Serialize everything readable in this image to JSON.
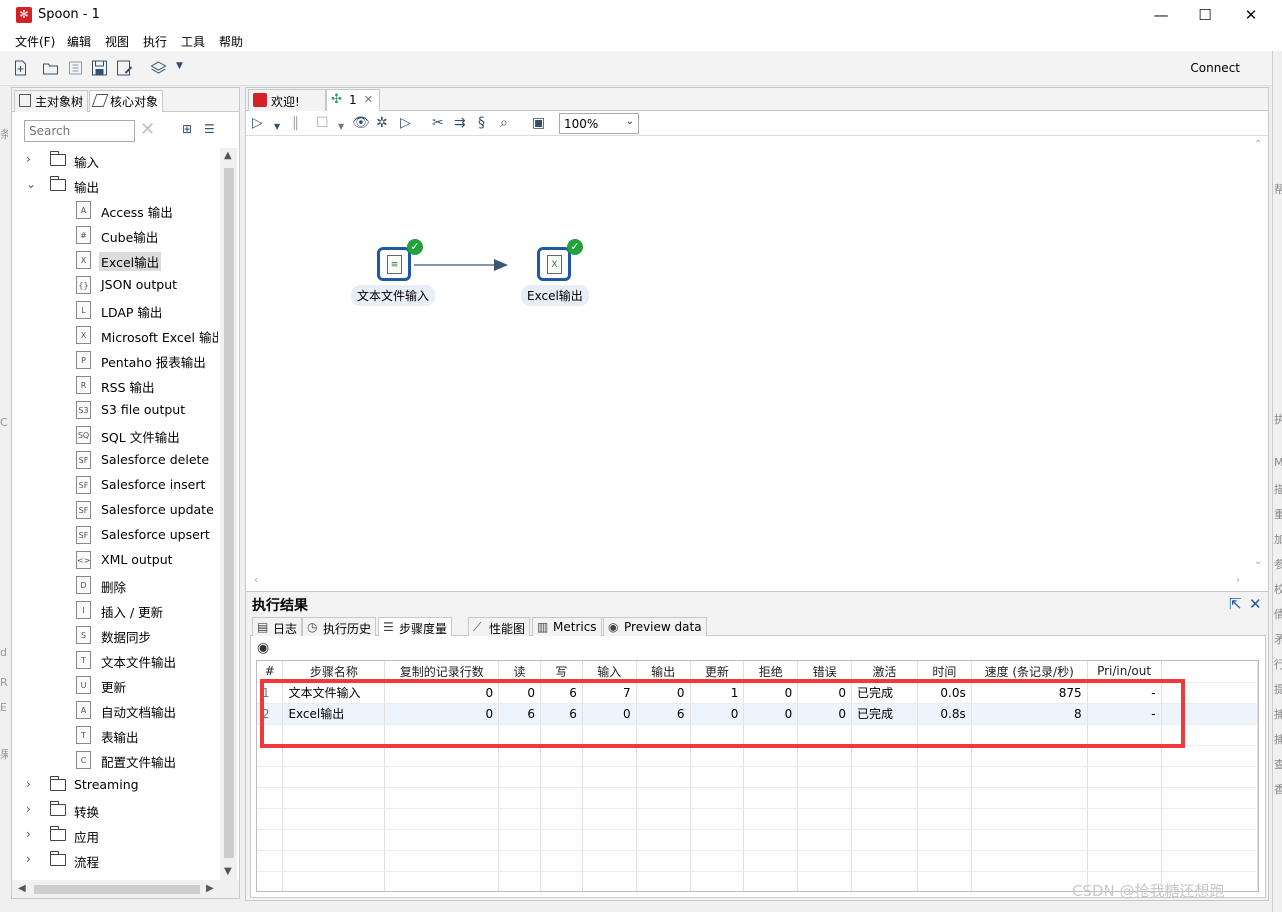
{
  "window": {
    "title": "Spoon - 1",
    "controls": {
      "minimize": "—",
      "maximize": "☐",
      "close": "✕"
    }
  },
  "menu": [
    "文件(F)",
    "编辑",
    "视图",
    "执行",
    "工具",
    "帮助"
  ],
  "toolbar": {
    "connect_label": "Connect"
  },
  "left_panel": {
    "tabs": [
      "主对象树",
      "核心对象"
    ],
    "search_placeholder": "Search",
    "tree": [
      {
        "label": "输入",
        "type": "folder",
        "expanded": false
      },
      {
        "label": "输出",
        "type": "folder",
        "expanded": true
      },
      {
        "label": "Access 输出",
        "type": "step",
        "icon": "A"
      },
      {
        "label": "Cube输出",
        "type": "step",
        "icon": "#"
      },
      {
        "label": "Excel输出",
        "type": "step",
        "icon": "X",
        "selected": true
      },
      {
        "label": "JSON output",
        "type": "step",
        "icon": "{}"
      },
      {
        "label": "LDAP 输出",
        "type": "step",
        "icon": "L"
      },
      {
        "label": "Microsoft Excel 输出",
        "type": "step",
        "icon": "X"
      },
      {
        "label": "Pentaho 报表输出",
        "type": "step",
        "icon": "P"
      },
      {
        "label": "RSS 输出",
        "type": "step",
        "icon": "R"
      },
      {
        "label": "S3 file output",
        "type": "step",
        "icon": "S3"
      },
      {
        "label": "SQL 文件输出",
        "type": "step",
        "icon": "SQ"
      },
      {
        "label": "Salesforce delete",
        "type": "step",
        "icon": "SF"
      },
      {
        "label": "Salesforce insert",
        "type": "step",
        "icon": "SF"
      },
      {
        "label": "Salesforce update",
        "type": "step",
        "icon": "SF"
      },
      {
        "label": "Salesforce upsert",
        "type": "step",
        "icon": "SF"
      },
      {
        "label": "XML output",
        "type": "step",
        "icon": "<>"
      },
      {
        "label": "删除",
        "type": "step",
        "icon": "D"
      },
      {
        "label": "插入 / 更新",
        "type": "step",
        "icon": "I"
      },
      {
        "label": "数据同步",
        "type": "step",
        "icon": "S"
      },
      {
        "label": "文本文件输出",
        "type": "step",
        "icon": "T"
      },
      {
        "label": "更新",
        "type": "step",
        "icon": "U"
      },
      {
        "label": "自动文档输出",
        "type": "step",
        "icon": "A"
      },
      {
        "label": "表输出",
        "type": "step",
        "icon": "T"
      },
      {
        "label": "配置文件输出",
        "type": "step",
        "icon": "C"
      },
      {
        "label": "Streaming",
        "type": "folder",
        "expanded": false
      },
      {
        "label": "转换",
        "type": "folder",
        "expanded": false
      },
      {
        "label": "应用",
        "type": "folder",
        "expanded": false
      },
      {
        "label": "流程",
        "type": "folder",
        "expanded": false
      }
    ]
  },
  "editor": {
    "tabs": [
      {
        "label": "欢迎!"
      },
      {
        "label": "1"
      }
    ],
    "zoom": "100%",
    "steps": [
      {
        "label": "文本文件输入",
        "icon": "≡"
      },
      {
        "label": "Excel输出",
        "icon": "X"
      }
    ]
  },
  "results": {
    "title": "执行结果",
    "tabs": [
      "日志",
      "执行历史",
      "步骤度量",
      "性能图",
      "Metrics",
      "Preview data"
    ],
    "columns": [
      "#",
      "步骤名称",
      "复制的记录行数",
      "读",
      "写",
      "输入",
      "输出",
      "更新",
      "拒绝",
      "错误",
      "激活",
      "时间",
      "速度 (条记录/秒)",
      "Pri/in/out"
    ],
    "rows": [
      [
        "1",
        "文本文件输入",
        "0",
        "0",
        "6",
        "7",
        "0",
        "1",
        "0",
        "0",
        "已完成",
        "0.0s",
        "875",
        "-"
      ],
      [
        "2",
        "Excel输出",
        "0",
        "6",
        "6",
        "0",
        "6",
        "0",
        "0",
        "0",
        "已完成",
        "0.8s",
        "8",
        "-"
      ]
    ]
  },
  "watermark": "CSDN @抢我糖还想跑",
  "colors": {
    "logo_red": "#d42027",
    "step_border": "#1d5aa4",
    "ok_green": "#1fa33a",
    "highlight_red": "#ee3a3a"
  }
}
